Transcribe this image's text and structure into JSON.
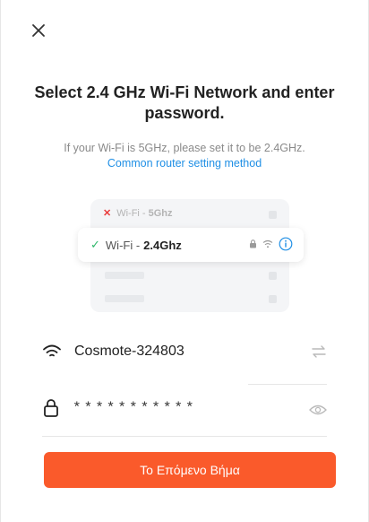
{
  "header": {
    "title": "Select 2.4 GHz Wi-Fi Network and enter password.",
    "subtitle": "If your Wi-Fi is 5GHz, please set it to be 2.4GHz.",
    "link": "Common router setting method"
  },
  "illustration": {
    "row1_prefix": "Wi-Fi - ",
    "row1_band": "5Ghz",
    "card_prefix": "Wi-Fi - ",
    "card_band": "2.4Ghz"
  },
  "form": {
    "ssid_value": "Cosmote-324803",
    "password_value": "***********"
  },
  "footer": {
    "next_label": "Το Επόμενο Βήμα"
  },
  "colors": {
    "accent": "#fa5a2b",
    "link": "#1f8fe5",
    "check": "#2fb86b",
    "error": "#ea3b3b"
  },
  "icons": {
    "close": "close-icon",
    "wifi": "wifi-icon",
    "lock": "lock-icon",
    "switch": "switch-network-icon",
    "eye": "eye-icon",
    "info": "info-icon"
  }
}
